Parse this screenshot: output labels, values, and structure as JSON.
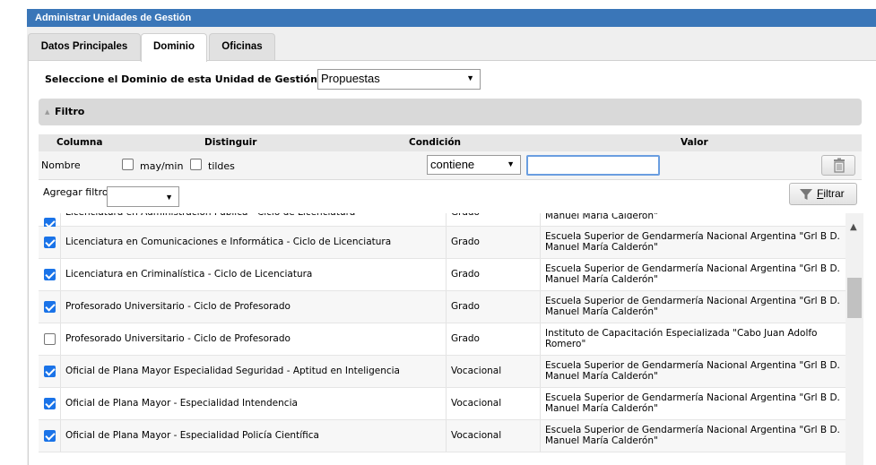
{
  "panel": {
    "title": "Administrar Unidades de Gestión"
  },
  "tabs": [
    {
      "label": "Datos Principales",
      "active": false
    },
    {
      "label": "Dominio",
      "active": true
    },
    {
      "label": "Oficinas",
      "active": false
    }
  ],
  "domain": {
    "label": "Seleccione el Dominio de esta Unidad de Gestión (*)",
    "selected": "Propuestas"
  },
  "filter": {
    "section_label": "Filtro",
    "headers": {
      "column": "Columna",
      "distinguish": "Distinguir",
      "condition": "Condición",
      "value": "Valor"
    },
    "row": {
      "column": "Nombre",
      "case_label": "may/min",
      "case_checked": false,
      "accents_label": "tildes",
      "accents_checked": false,
      "condition": "contiene",
      "value": ""
    },
    "add_label": "Agregar filtro",
    "add_selected": "",
    "filter_button": "Filtrar",
    "filter_button_underline": "F",
    "filter_button_rest": "iltrar"
  },
  "rows": [
    {
      "checked": true,
      "name": "Licenciatura en Administración Pública - Ciclo de Licenciatura",
      "tipo": "Grado",
      "inst_1": "",
      "inst_2": "Manuel María Calderón\""
    },
    {
      "checked": true,
      "name": "Licenciatura en Comunicaciones e Informática - Ciclo de Licenciatura",
      "tipo": "Grado",
      "inst_1": "Escuela Superior de Gendarmería Nacional Argentina \"Grl B D.",
      "inst_2": "Manuel María Calderón\""
    },
    {
      "checked": true,
      "name": "Licenciatura en Criminalística - Ciclo de Licenciatura",
      "tipo": "Grado",
      "inst_1": "Escuela Superior de Gendarmería Nacional Argentina \"Grl B D.",
      "inst_2": "Manuel María Calderón\""
    },
    {
      "checked": true,
      "name": "Profesorado Universitario - Ciclo de Profesorado",
      "tipo": "Grado",
      "inst_1": "Escuela Superior de Gendarmería Nacional Argentina \"Grl B D.",
      "inst_2": "Manuel María Calderón\""
    },
    {
      "checked": false,
      "name": "Profesorado Universitario - Ciclo de Profesorado",
      "tipo": "Grado",
      "inst_1": "Instituto de Capacitación Especializada \"Cabo Juan Adolfo",
      "inst_2": "Romero\""
    },
    {
      "checked": true,
      "name": "Oficial de Plana Mayor Especialidad Seguridad - Aptitud en Inteligencia",
      "tipo": "Vocacional",
      "inst_1": "Escuela Superior de Gendarmería Nacional Argentina \"Grl B D.",
      "inst_2": "Manuel María Calderón\""
    },
    {
      "checked": true,
      "name": "Oficial de Plana Mayor - Especialidad Intendencia",
      "tipo": "Vocacional",
      "inst_1": "Escuela Superior de Gendarmería Nacional Argentina \"Grl B D.",
      "inst_2": "Manuel María Calderón\""
    },
    {
      "checked": true,
      "name": "Oficial de Plana Mayor - Especialidad Policía Científica",
      "tipo": "Vocacional",
      "inst_1": "Escuela Superior de Gendarmería Nacional Argentina \"Grl B D.",
      "inst_2": "Manuel María Calderón\""
    }
  ]
}
